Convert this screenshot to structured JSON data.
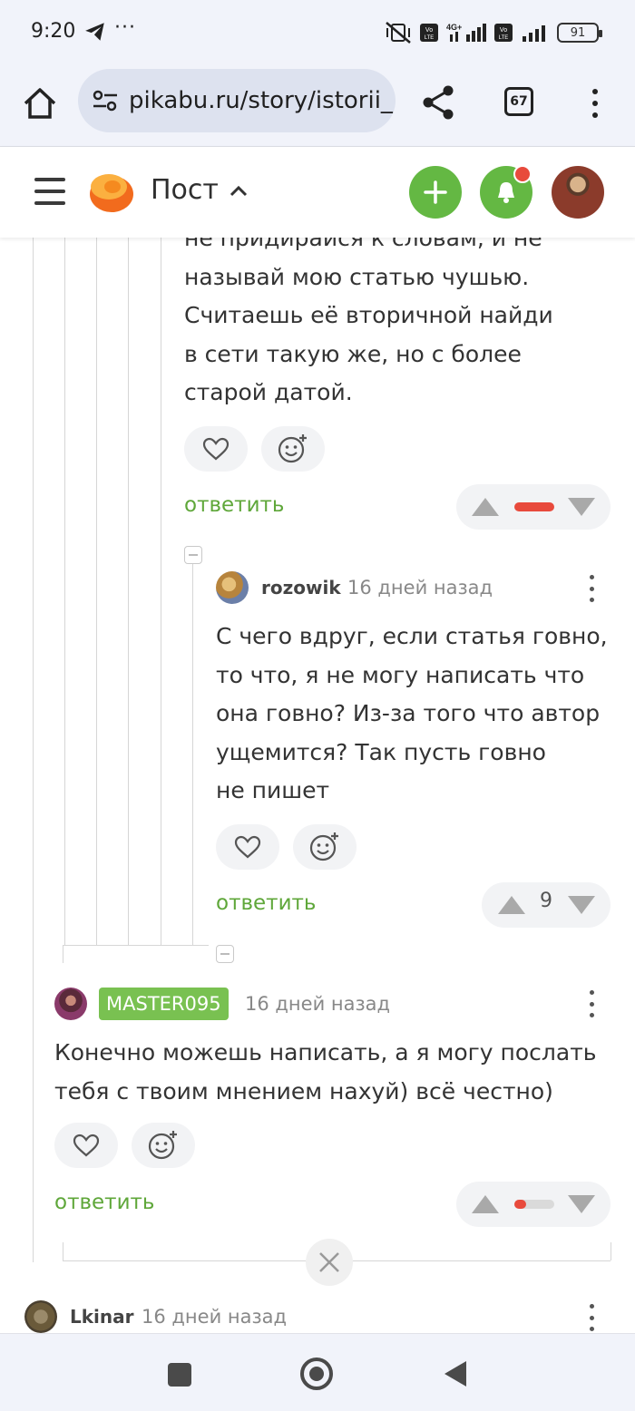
{
  "status_bar": {
    "time": "9:20",
    "more": "···",
    "battery": "91"
  },
  "browser": {
    "url": "pikabu.ru/story/istorii_",
    "tab_count": "67"
  },
  "header": {
    "title": "Пост"
  },
  "comment_top": {
    "lines": [
      "не придирайся к словам, и не",
      "называй мою статью чушью.",
      "Считаешь её вторичной найди",
      "в сети такую же, но с более",
      "старой датой."
    ],
    "reply_label": "ответить",
    "rating_color": "#e84a3c"
  },
  "comment_rozowik": {
    "username": "rozowik",
    "date": "16 дней назад",
    "lines": [
      "С чего вдруг, если статья говно,",
      "то что, я не могу написать что",
      "она говно? Из-за того что автор",
      "ущемится? Так пусть говно",
      "не пишет"
    ],
    "reply_label": "ответить",
    "score": "9"
  },
  "comment_master": {
    "username": "MASTER095",
    "date": "16 дней назад",
    "lines": [
      "Конечно можешь написать, а я могу послать",
      "тебя с твоим мнением нахуй) всё честно)"
    ],
    "reply_label": "ответить",
    "rating_fraction": 0.3
  },
  "comment_lkinar": {
    "username": "Lkinar",
    "date": "16 дней назад"
  },
  "colors": {
    "accent_green": "#64b843",
    "reply_green": "#5fa73a",
    "badge_green": "#79c151",
    "notify_red": "#e84a3c"
  }
}
